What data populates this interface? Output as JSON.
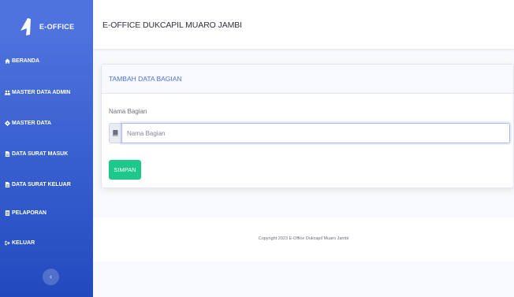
{
  "app": {
    "brand": "E-OFFICE",
    "page_title": "E-OFFICE DUKCAPIL MUARO JAMBI"
  },
  "sidebar": {
    "items": [
      {
        "label": "BERANDA",
        "icon": "home-icon"
      },
      {
        "label": "MASTER DATA ADMIN",
        "icon": "users-icon"
      },
      {
        "label": "MASTER DATA",
        "icon": "cog-icon"
      },
      {
        "label": "DATA SURAT MASUK",
        "icon": "file-icon"
      },
      {
        "label": "DATA SURAT KELUAR",
        "icon": "file-icon"
      },
      {
        "label": "PELAPORAN",
        "icon": "report-icon"
      },
      {
        "label": "KELUAR",
        "icon": "sign-out-icon"
      }
    ],
    "toggle_label": "‹"
  },
  "form": {
    "header": "TAMBAH DATA BAGIAN",
    "field_label": "Nama Bagian",
    "field_placeholder": "Nama Bagian",
    "field_value": "",
    "submit_label": "SIMPAN"
  },
  "footer": {
    "copyright": "Copyright 2023 E-Office Dukcapil Muaro Jambi"
  },
  "colors": {
    "sidebar_top": "#4e73df",
    "sidebar_bottom": "#224abe",
    "accent": "#4e73df",
    "success": "#1cc88a"
  }
}
